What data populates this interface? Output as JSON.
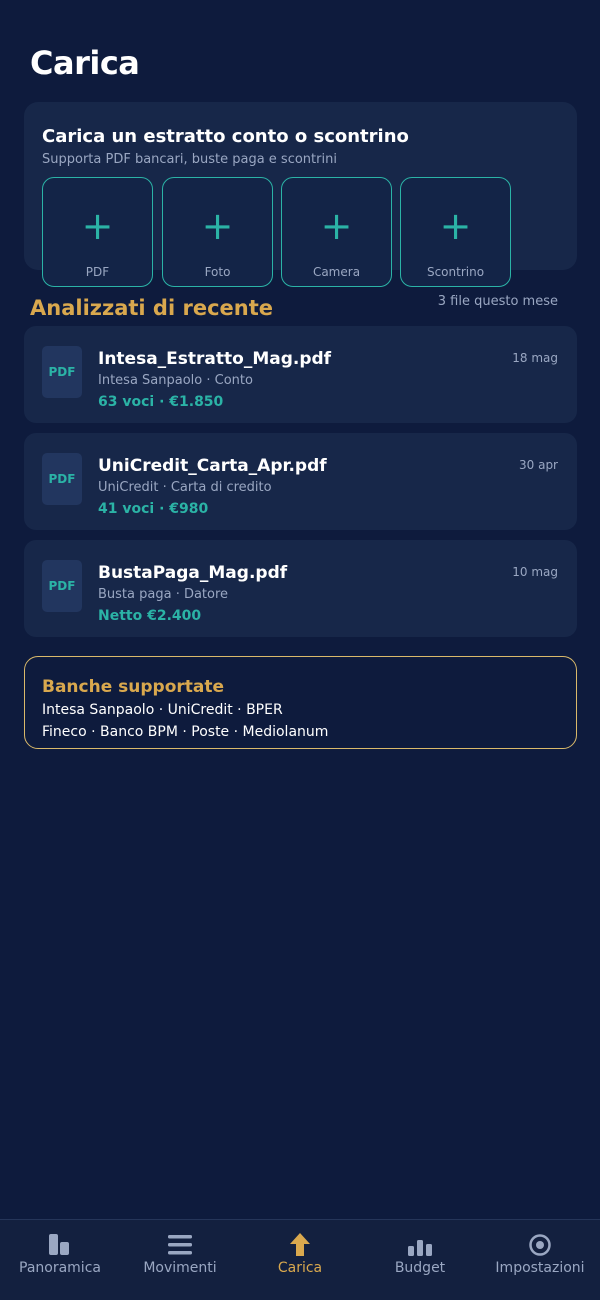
{
  "page_title": "Carica",
  "upload": {
    "title": "Carica un estratto conto o scontrino",
    "subtitle": "Supporta PDF bancari, buste paga e scontrini",
    "buttons": [
      {
        "label": "PDF",
        "icon": "+"
      },
      {
        "label": "Foto",
        "icon": "+"
      },
      {
        "label": "Camera",
        "icon": "+"
      },
      {
        "label": "Scontrino",
        "icon": "+"
      }
    ]
  },
  "recent": {
    "title": "Analizzati di recente",
    "meta": "3 file questo mese",
    "files": [
      {
        "badge": "PDF",
        "name": "Intesa_Estratto_Mag.pdf",
        "sub": "Intesa Sanpaolo · Conto",
        "amount": "63 voci · €1.850",
        "date": "18 mag"
      },
      {
        "badge": "PDF",
        "name": "UniCredit_Carta_Apr.pdf",
        "sub": "UniCredit · Carta di credito",
        "amount": "41 voci · €980",
        "date": "30 apr"
      },
      {
        "badge": "PDF",
        "name": "BustaPaga_Mag.pdf",
        "sub": "Busta paga · Datore",
        "amount": "Netto €2.400",
        "date": "10 mag"
      }
    ]
  },
  "banks": {
    "title": "Banche supportate",
    "line1": "Intesa Sanpaolo · UniCredit · BPER",
    "line2": "Fineco · Banco BPM · Poste · Mediolanum"
  },
  "nav": {
    "active": "Carica",
    "items": [
      {
        "label": "Panoramica",
        "icon": "overview-icon"
      },
      {
        "label": "Movimenti",
        "icon": "list-icon"
      },
      {
        "label": "Carica",
        "icon": "upload-arrow-icon"
      },
      {
        "label": "Budget",
        "icon": "bar-chart-icon"
      },
      {
        "label": "Impostazioni",
        "icon": "settings-icon"
      }
    ]
  },
  "colors": {
    "background": "#0e1b3d",
    "card": "#172749",
    "accent_teal": "#2bb3a6",
    "accent_gold": "#d9a84e"
  }
}
